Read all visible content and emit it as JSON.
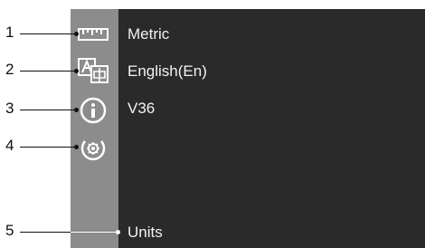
{
  "menu": {
    "items": [
      {
        "icon": "ruler-icon",
        "value": "Metric"
      },
      {
        "icon": "language-translate-icon",
        "value": "English(En)"
      },
      {
        "icon": "info-icon",
        "value": "V36"
      },
      {
        "icon": "settings-gear-icon",
        "value": ""
      }
    ],
    "caption": "Units"
  },
  "callouts": [
    "1",
    "2",
    "3",
    "4",
    "5"
  ],
  "colors": {
    "screen": "#2a2a2a",
    "sidebar": "#8c8c8c",
    "text": "#f2f2f2"
  }
}
